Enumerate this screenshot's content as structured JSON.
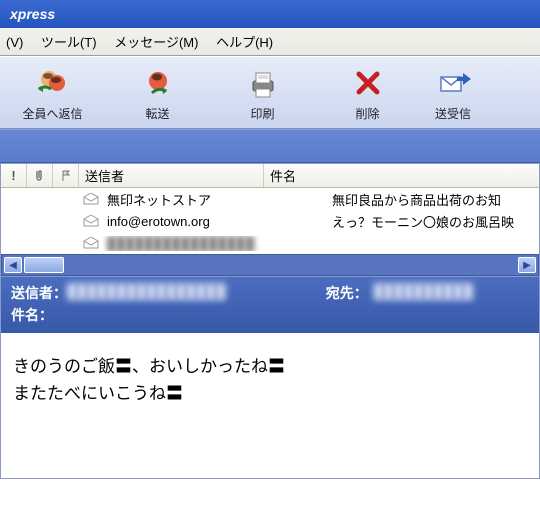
{
  "title": "xpress",
  "menu": {
    "view": "(V)",
    "tool": "ツール(T)",
    "message": "メッセージ(M)",
    "help": "ヘルプ(H)"
  },
  "toolbar": {
    "reply_all": "全員へ返信",
    "forward": "転送",
    "print": "印刷",
    "delete": "削除",
    "sendrecv": "送受信"
  },
  "columns": {
    "flag": "!",
    "attach": "attach",
    "mark": "flag",
    "sender": "送信者",
    "subject": "件名"
  },
  "rows": [
    {
      "sender": "無印ネットストア",
      "subject": "無印良品から商品出荷のお知",
      "blurred": false
    },
    {
      "sender": "info@erotown.org",
      "subject": "えっ？モーニン〇娘のお風呂映",
      "blurred": false
    },
    {
      "sender": "████████████████.",
      "subject": "",
      "blurred": true
    }
  ],
  "preview": {
    "from_label": "送信者：",
    "from_value": "████████████████",
    "to_label": "宛先：",
    "to_value": "██████████",
    "subject_label": "件名：",
    "subject_value": "",
    "body_line1": "きのうのご飯〓、おいしかったね〓",
    "body_line2": "またたべにいこうね〓"
  }
}
